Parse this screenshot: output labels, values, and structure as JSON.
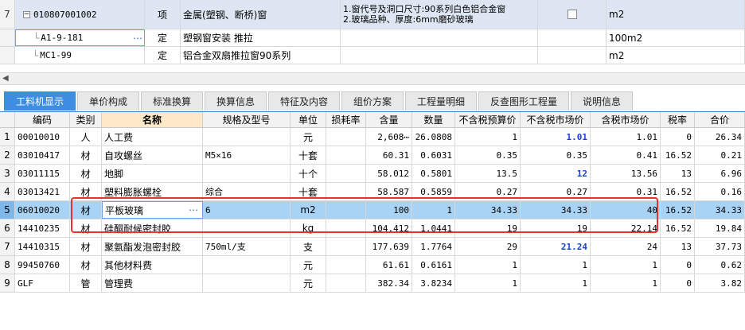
{
  "top_rows": [
    {
      "rownum": "7",
      "code": "010807001002",
      "type": "项",
      "name": "金属(塑钢、断桥)窗",
      "feature_line1": "1.窗代号及洞口尺寸:90系列白色铝合金窗",
      "feature_line2": "2.玻璃品种、厚度:6mm磨砂玻璃",
      "unit": "m2"
    },
    {
      "rownum": "",
      "code": "A1-9-181",
      "type": "定",
      "name": "塑钢窗安装 推拉",
      "unit": "100m2"
    },
    {
      "rownum": "",
      "code": "MC1-99",
      "type": "定",
      "name": "铝合金双扇推拉窗90系列",
      "unit": "m2"
    }
  ],
  "tabs": [
    "工料机显示",
    "单价构成",
    "标准换算",
    "换算信息",
    "特征及内容",
    "组价方案",
    "工程量明细",
    "反查图形工程量",
    "说明信息"
  ],
  "headers": {
    "rownum": "",
    "code": "编码",
    "category": "类别",
    "name": "名称",
    "spec": "规格及型号",
    "unit": "单位",
    "loss": "损耗率",
    "content": "含量",
    "quantity": "数量",
    "budget_price": "不含税预算价",
    "market_price": "不含税市场价",
    "tax_market_price": "含税市场价",
    "tax_rate": "税率",
    "total": "合价"
  },
  "rows": [
    {
      "n": "1",
      "code": "00010010",
      "cat": "人",
      "name": "人工费",
      "spec": "",
      "unit": "元",
      "content": "2,608⋯",
      "qty": "26.0808",
      "budget": "1",
      "market": "1.01",
      "market_blue": true,
      "taxmarket": "1.01",
      "rate": "0",
      "total": "26.34"
    },
    {
      "n": "2",
      "code": "03010417",
      "cat": "材",
      "name": "自攻螺丝",
      "spec": "M5×16",
      "unit": "十套",
      "content": "60.31",
      "qty": "0.6031",
      "budget": "0.35",
      "market": "0.35",
      "market_blue": false,
      "taxmarket": "0.41",
      "rate": "16.52",
      "total": "0.21"
    },
    {
      "n": "3",
      "code": "03011115",
      "cat": "材",
      "name": "地脚",
      "spec": "",
      "unit": "十个",
      "content": "58.012",
      "qty": "0.5801",
      "budget": "13.5",
      "market": "12",
      "market_blue": true,
      "taxmarket": "13.56",
      "rate": "13",
      "total": "6.96"
    },
    {
      "n": "4",
      "code": "03013421",
      "cat": "材",
      "name": "塑料膨胀螺栓",
      "spec": "综合",
      "unit": "十套",
      "content": "58.587",
      "qty": "0.5859",
      "budget": "0.27",
      "market": "0.27",
      "market_blue": false,
      "taxmarket": "0.31",
      "rate": "16.52",
      "total": "0.16"
    },
    {
      "n": "5",
      "code": "06010020",
      "cat": "材",
      "name": "平板玻璃",
      "spec": "6",
      "unit": "m2",
      "content": "100",
      "qty": "1",
      "budget": "34.33",
      "market": "34.33",
      "market_blue": false,
      "taxmarket": "40",
      "rate": "16.52",
      "total": "34.33"
    },
    {
      "n": "6",
      "code": "14410235",
      "cat": "材",
      "name": "硅酮耐候密封胶",
      "spec": "",
      "unit": "kg",
      "content": "104.412",
      "qty": "1.0441",
      "budget": "19",
      "market": "19",
      "market_blue": false,
      "taxmarket": "22.14",
      "rate": "16.52",
      "total": "19.84"
    },
    {
      "n": "7",
      "code": "14410315",
      "cat": "材",
      "name": "聚氨酯发泡密封胶",
      "spec": "750ml/支",
      "unit": "支",
      "content": "177.639",
      "qty": "1.7764",
      "budget": "29",
      "market": "21.24",
      "market_blue": true,
      "taxmarket": "24",
      "rate": "13",
      "total": "37.73"
    },
    {
      "n": "8",
      "code": "99450760",
      "cat": "材",
      "name": "其他材料费",
      "spec": "",
      "unit": "元",
      "content": "61.61",
      "qty": "0.6161",
      "budget": "1",
      "market": "1",
      "market_blue": false,
      "taxmarket": "1",
      "rate": "0",
      "total": "0.62"
    },
    {
      "n": "9",
      "code": "GLF",
      "cat": "管",
      "name": "管理费",
      "spec": "",
      "unit": "元",
      "content": "382.34",
      "qty": "3.8234",
      "budget": "1",
      "market": "1",
      "market_blue": false,
      "taxmarket": "1",
      "rate": "0",
      "total": "3.82"
    }
  ],
  "selected_row": "5",
  "colors": {
    "accent": "#3d8ee0",
    "selected": "#a9d3f5",
    "highlight_box": "#e8322b",
    "blue_value": "#1a3fd6"
  }
}
